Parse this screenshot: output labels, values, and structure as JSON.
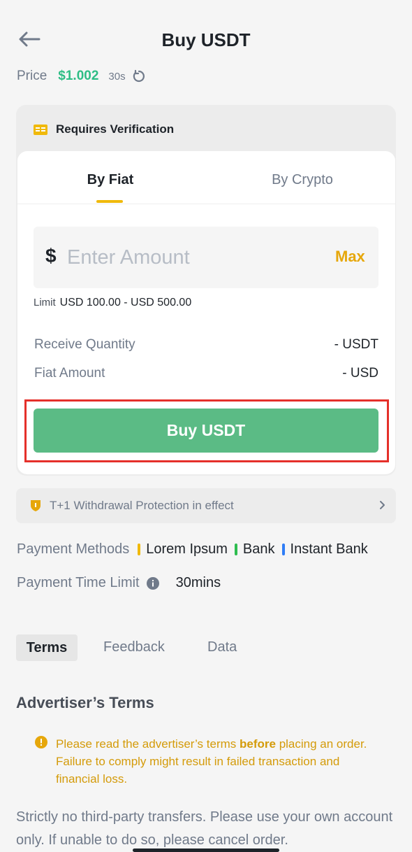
{
  "header": {
    "title": "Buy USDT"
  },
  "price": {
    "label": "Price",
    "value": "$1.002",
    "timer": "30s"
  },
  "verification": {
    "text": "Requires Verification"
  },
  "tabs": {
    "fiat": "By Fiat",
    "crypto": "By Crypto",
    "active": "By Fiat"
  },
  "amount_input": {
    "currency_symbol": "$",
    "placeholder": "Enter Amount",
    "max_label": "Max"
  },
  "limit": {
    "label": "Limit",
    "value": "USD 100.00 - USD 500.00"
  },
  "summary": {
    "receive_label": "Receive Quantity",
    "receive_value": "- USDT",
    "fiat_label": "Fiat Amount",
    "fiat_value": "- USD"
  },
  "buy_button": {
    "label": "Buy USDT"
  },
  "protection": {
    "text": "T+1 Withdrawal Protection in effect"
  },
  "payment": {
    "label": "Payment Methods",
    "methods": [
      {
        "name": "Lorem Ipsum",
        "color": "#f0b90b"
      },
      {
        "name": "Bank",
        "color": "#2ebd4f"
      },
      {
        "name": "Instant Bank",
        "color": "#2f7df6"
      }
    ],
    "time_limit_label": "Payment Time Limit",
    "time_limit_value": "30mins"
  },
  "bottom_tabs": {
    "terms": "Terms",
    "feedback": "Feedback",
    "data": "Data"
  },
  "advertiser": {
    "title": "Advertiser’s Terms",
    "warning_pre": "Please read the advertiser’s terms ",
    "warning_bold": "before",
    "warning_post": " placing an order. Failure to comply might result in failed transaction and financial loss.",
    "terms": "Strictly no third-party transfers. Please use your own account only. If unable to do so, please cancel order."
  },
  "colors": {
    "accent_yellow": "#f0b90b",
    "buy_green": "#5bbb85",
    "price_green": "#2ebd85",
    "highlight_red": "#e5302a"
  }
}
